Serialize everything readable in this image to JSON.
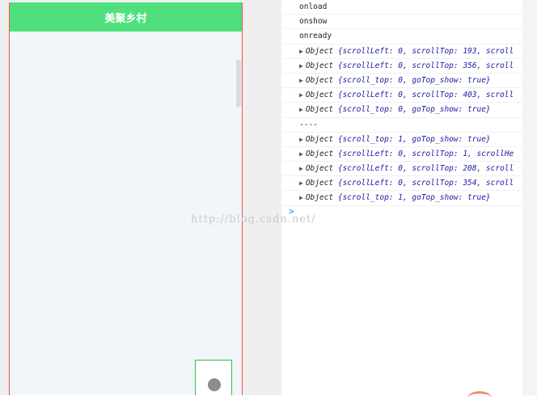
{
  "navbar": {
    "title": "美聚乡村"
  },
  "console": {
    "logs": [
      {
        "type": "text",
        "text": "onload"
      },
      {
        "type": "text",
        "text": "onshow"
      },
      {
        "type": "text",
        "text": "onready"
      },
      {
        "type": "object",
        "text": "{scrollLeft: 0, scrollTop: 193, scroll"
      },
      {
        "type": "object",
        "text": "{scrollLeft: 0, scrollTop: 356, scroll"
      },
      {
        "type": "object",
        "text": "{scroll_top: 0, goTop_show: true}"
      },
      {
        "type": "object",
        "text": "{scrollLeft: 0, scrollTop: 403, scroll"
      },
      {
        "type": "object",
        "text": "{scroll_top: 0, goTop_show: true}"
      },
      {
        "type": "text",
        "text": "----"
      },
      {
        "type": "object",
        "text": "{scroll_top: 1, goTop_show: true}"
      },
      {
        "type": "object",
        "text": "{scrollLeft: 0, scrollTop: 1, scrollHe"
      },
      {
        "type": "object",
        "text": "{scrollLeft: 0, scrollTop: 208, scroll"
      },
      {
        "type": "object",
        "text": "{scrollLeft: 0, scrollTop: 354, scroll"
      },
      {
        "type": "object",
        "text": "{scroll_top: 1, goTop_show: true}"
      }
    ],
    "object_label": "Object",
    "prompt": ">"
  },
  "watermark": "http://blog.csdn.net/",
  "icons": {
    "expand": "triangle-right-icon",
    "go_top": "circle-icon"
  }
}
